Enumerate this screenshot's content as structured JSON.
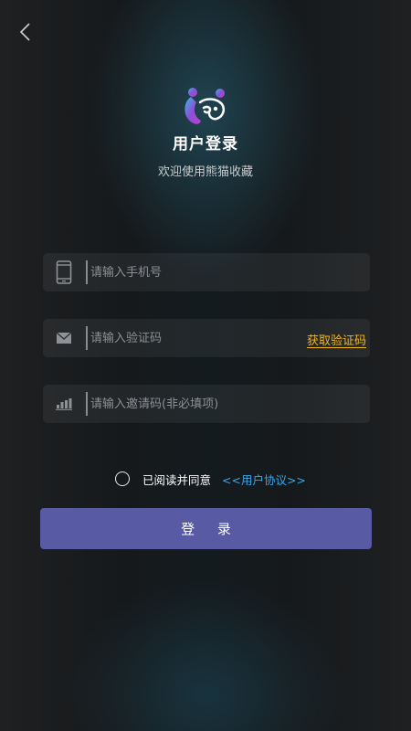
{
  "header": {
    "back_icon": "chevron-left-icon",
    "title": "用户登录",
    "subtitle": "欢迎使用熊猫收藏"
  },
  "logo": {
    "icon": "panda-logo-icon",
    "colors": [
      "#3fb8e8",
      "#8a4fd8",
      "#c040c8"
    ]
  },
  "form": {
    "phone": {
      "icon": "phone-icon",
      "placeholder": "请输入手机号",
      "value": ""
    },
    "code": {
      "icon": "envelope-icon",
      "placeholder": "请输入验证码",
      "value": "",
      "get_code_label": "获取验证码"
    },
    "invite": {
      "icon": "signal-bars-icon",
      "placeholder": "请输入邀请码(非必填项)",
      "value": ""
    }
  },
  "agreement": {
    "checked": false,
    "text": "已阅读并同意",
    "link": "<<用户协议>>"
  },
  "login_button": {
    "label": "登 录"
  },
  "colors": {
    "accent_link": "#3aa8ea",
    "get_code": "#f2b61e",
    "button": "#585aa3"
  }
}
